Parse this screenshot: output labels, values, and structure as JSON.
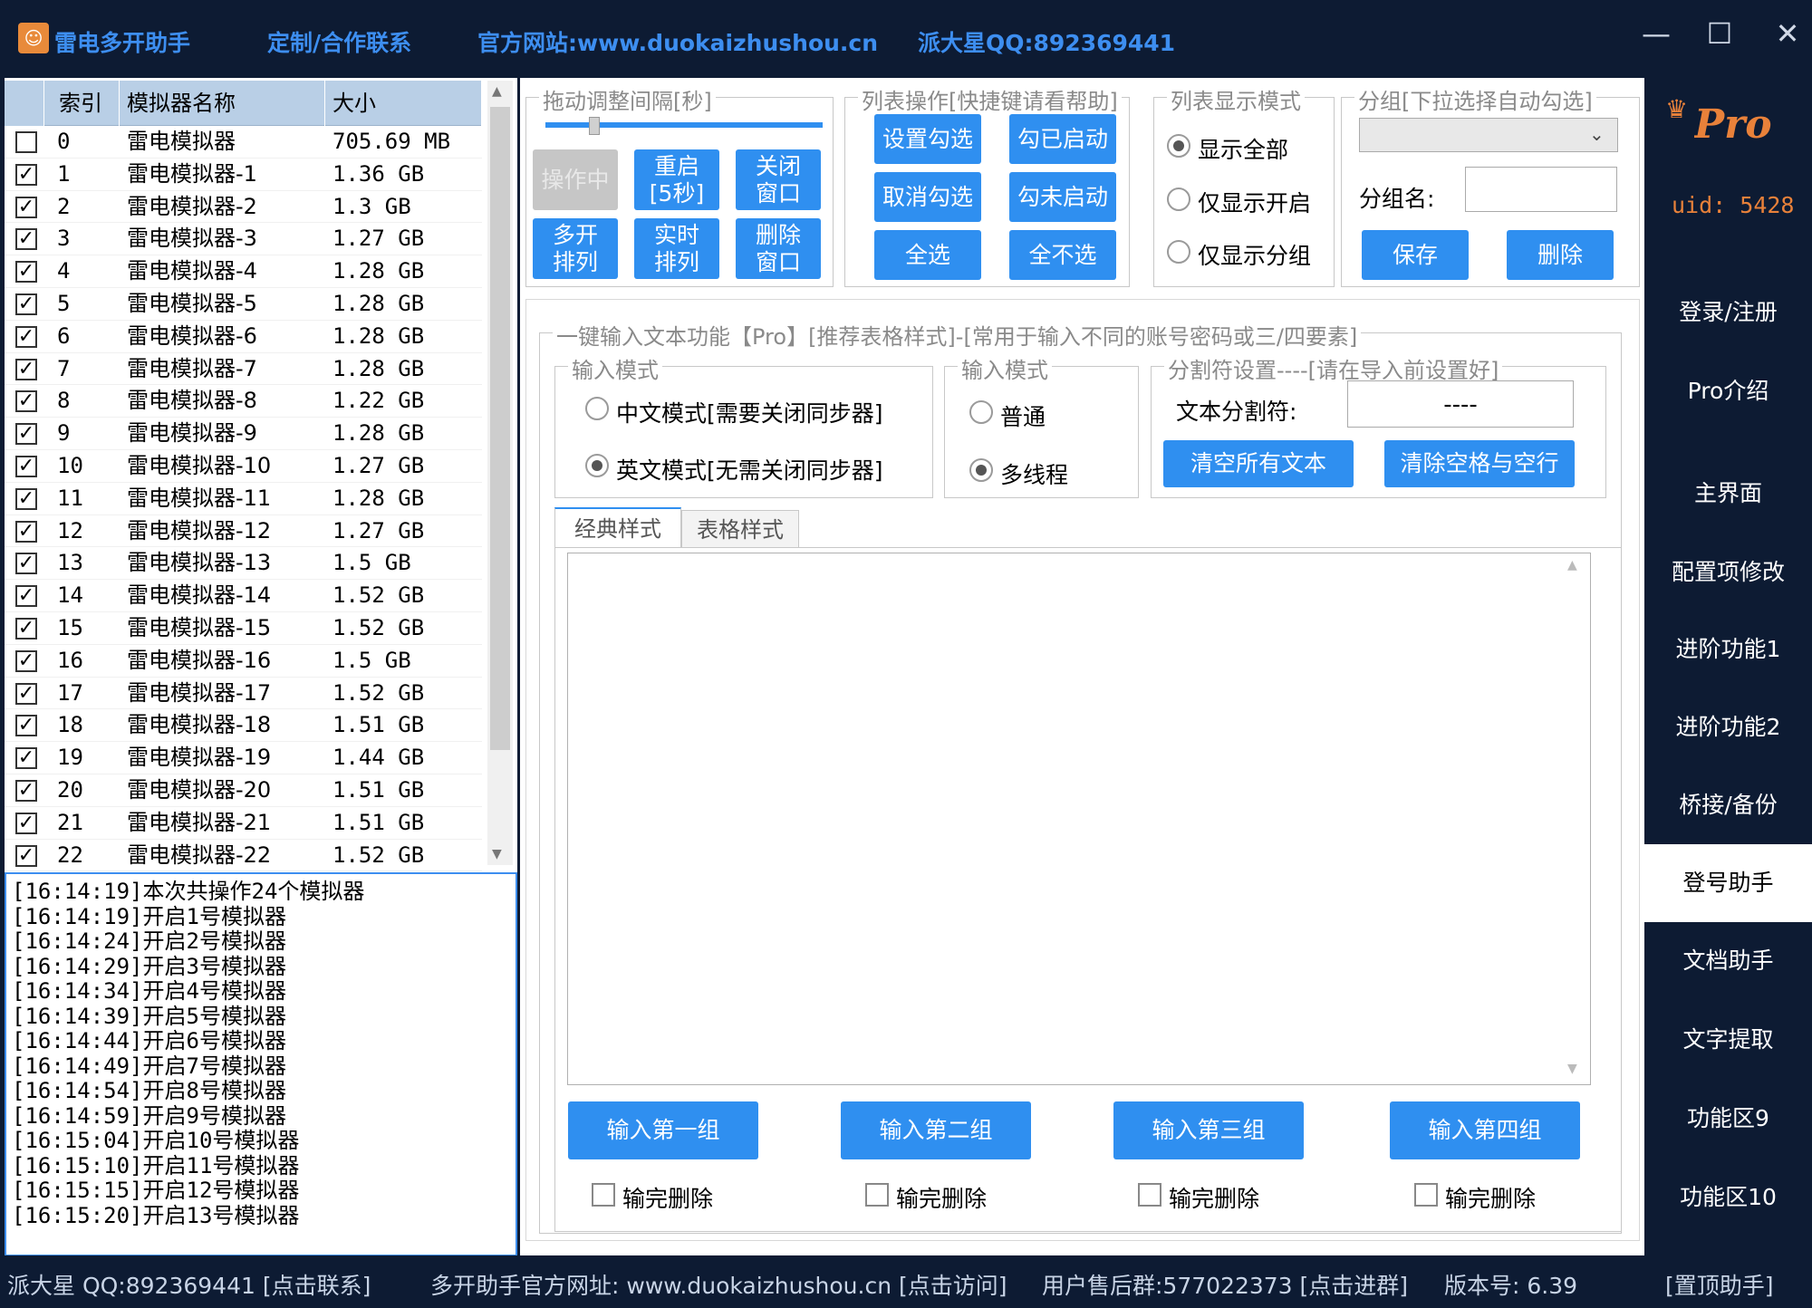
{
  "titlebar": {
    "app_name": "雷电多开助手",
    "contact": "定制/合作联系",
    "website": "官方网站:www.duokaizhushou.cn",
    "qq": "派大星QQ:892369441",
    "minimize": "—",
    "maximize": "☐",
    "close": "✕"
  },
  "table": {
    "headers": [
      "索引",
      "模拟器名称",
      "大小"
    ],
    "rows": [
      {
        "checked": false,
        "index": "0",
        "name": "雷电模拟器",
        "size": "705.69 MB"
      },
      {
        "checked": true,
        "index": "1",
        "name": "雷电模拟器-1",
        "size": "1.36 GB"
      },
      {
        "checked": true,
        "index": "2",
        "name": "雷电模拟器-2",
        "size": "1.3 GB"
      },
      {
        "checked": true,
        "index": "3",
        "name": "雷电模拟器-3",
        "size": "1.27 GB"
      },
      {
        "checked": true,
        "index": "4",
        "name": "雷电模拟器-4",
        "size": "1.28 GB"
      },
      {
        "checked": true,
        "index": "5",
        "name": "雷电模拟器-5",
        "size": "1.28 GB"
      },
      {
        "checked": true,
        "index": "6",
        "name": "雷电模拟器-6",
        "size": "1.28 GB"
      },
      {
        "checked": true,
        "index": "7",
        "name": "雷电模拟器-7",
        "size": "1.28 GB"
      },
      {
        "checked": true,
        "index": "8",
        "name": "雷电模拟器-8",
        "size": "1.22 GB"
      },
      {
        "checked": true,
        "index": "9",
        "name": "雷电模拟器-9",
        "size": "1.28 GB"
      },
      {
        "checked": true,
        "index": "10",
        "name": "雷电模拟器-10",
        "size": "1.27 GB"
      },
      {
        "checked": true,
        "index": "11",
        "name": "雷电模拟器-11",
        "size": "1.28 GB"
      },
      {
        "checked": true,
        "index": "12",
        "name": "雷电模拟器-12",
        "size": "1.27 GB"
      },
      {
        "checked": true,
        "index": "13",
        "name": "雷电模拟器-13",
        "size": "1.5 GB"
      },
      {
        "checked": true,
        "index": "14",
        "name": "雷电模拟器-14",
        "size": "1.52 GB"
      },
      {
        "checked": true,
        "index": "15",
        "name": "雷电模拟器-15",
        "size": "1.52 GB"
      },
      {
        "checked": true,
        "index": "16",
        "name": "雷电模拟器-16",
        "size": "1.5 GB"
      },
      {
        "checked": true,
        "index": "17",
        "name": "雷电模拟器-17",
        "size": "1.52 GB"
      },
      {
        "checked": true,
        "index": "18",
        "name": "雷电模拟器-18",
        "size": "1.51 GB"
      },
      {
        "checked": true,
        "index": "19",
        "name": "雷电模拟器-19",
        "size": "1.44 GB"
      },
      {
        "checked": true,
        "index": "20",
        "name": "雷电模拟器-20",
        "size": "1.51 GB"
      },
      {
        "checked": true,
        "index": "21",
        "name": "雷电模拟器-21",
        "size": "1.51 GB"
      },
      {
        "checked": true,
        "index": "22",
        "name": "雷电模拟器-22",
        "size": "1.52 GB"
      }
    ]
  },
  "log": [
    "[16:14:19]本次共操作24个模拟器",
    "[16:14:19]开启1号模拟器",
    "[16:14:24]开启2号模拟器",
    "[16:14:29]开启3号模拟器",
    "[16:14:34]开启4号模拟器",
    "[16:14:39]开启5号模拟器",
    "[16:14:44]开启6号模拟器",
    "[16:14:49]开启7号模拟器",
    "[16:14:54]开启8号模拟器",
    "[16:14:59]开启9号模拟器",
    "[16:15:04]开启10号模拟器",
    "[16:15:10]开启11号模拟器",
    "[16:15:15]开启12号模拟器",
    "[16:15:20]开启13号模拟器"
  ],
  "interval_group": {
    "title": "拖动调整间隔[秒]",
    "busy": "操作中",
    "restart": [
      "重启",
      "[5秒]"
    ],
    "close_window": [
      "关闭",
      "窗口"
    ],
    "multi_arrange": [
      "多开",
      "排列"
    ],
    "realtime_arrange": [
      "实时",
      "排列"
    ],
    "delete_window": [
      "删除",
      "窗口"
    ]
  },
  "list_ops": {
    "title": "列表操作[快捷键请看帮助]",
    "set_check": "设置勾选",
    "check_started": "勾已启动",
    "uncheck": "取消勾选",
    "check_not_started": "勾未启动",
    "select_all": "全选",
    "select_none": "全不选"
  },
  "display_mode": {
    "title": "列表显示模式",
    "show_all": "显示全部",
    "show_started": "仅显示开启",
    "show_group": "仅显示分组"
  },
  "group_box": {
    "title": "分组[下拉选择自动勾选]",
    "name_label": "分组名:",
    "name_value": "",
    "save": "保存",
    "delete": "删除"
  },
  "pro": {
    "logo": "Pro",
    "uid_label": "uid:",
    "uid": "5428"
  },
  "text_input": {
    "title": "一键输入文本功能【Pro】[推荐表格样式]-[常用于输入不同的账号密码或三/四要素]",
    "mode1_title": "输入模式",
    "mode_cn": "中文模式[需要关闭同步器]",
    "mode_en": "英文模式[无需关闭同步器]",
    "mode2_title": "输入模式",
    "normal": "普通",
    "multithread": "多线程",
    "sep_title": "分割符设置----[请在导入前设置好]",
    "sep_label": "文本分割符:",
    "sep_value": "----",
    "clear_all": "清空所有文本",
    "clear_spaces": "清除空格与空行",
    "tab_classic": "经典样式",
    "tab_table": "表格样式",
    "textarea_value": "",
    "inputs": [
      "输入第一组",
      "输入第二组",
      "输入第三组",
      "输入第四组"
    ],
    "delete_after": "输完删除"
  },
  "sidebar": [
    "登录/注册",
    "Pro介绍",
    "主界面",
    "配置项修改",
    "进阶功能1",
    "进阶功能2",
    "桥接/备份",
    "登号助手",
    "文档助手",
    "文字提取",
    "功能区9",
    "功能区10"
  ],
  "status": {
    "qq": "派大星 QQ:892369441 [点击联系]",
    "site": "多开助手官方网址: www.duokaizhushou.cn [点击访问]",
    "group": "用户售后群:577022373 [点击进群]",
    "version": "版本号: 6.39",
    "pin": "[置顶助手]"
  },
  "colors": {
    "accent": "#2f8ff0",
    "bg": "#0d1b33",
    "uid": "#e8813a",
    "pro": "#e8813a"
  }
}
